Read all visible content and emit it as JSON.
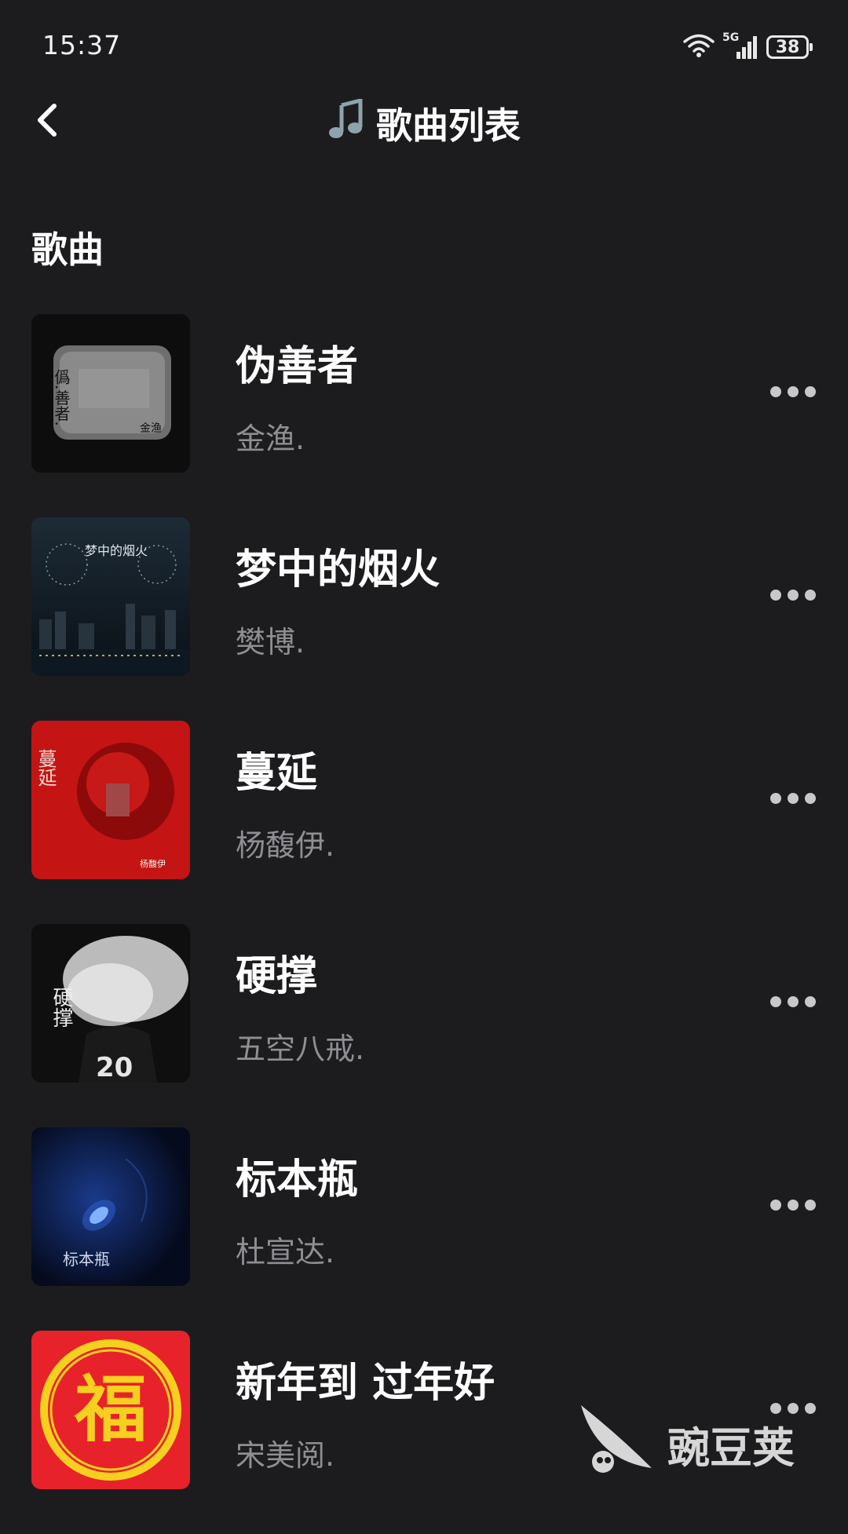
{
  "status_bar": {
    "time": "15:37",
    "network": "5G",
    "battery": "38"
  },
  "header": {
    "title": "歌曲列表",
    "back_icon": "chevron-left-icon",
    "title_icon": "music-note-icon"
  },
  "section": {
    "title": "歌曲"
  },
  "songs": [
    {
      "title": "伪善者",
      "artist": "金渔.",
      "cover_text": "僞.善者.",
      "cover_sub": "金渔"
    },
    {
      "title": "梦中的烟火",
      "artist": "樊博.",
      "cover_text": "梦中的烟火"
    },
    {
      "title": "蔓延",
      "artist": "杨馥伊.",
      "cover_text": "蔓延",
      "cover_sub": "杨馥伊"
    },
    {
      "title": "硬撑",
      "artist": "五空八戒.",
      "cover_text": "硬撑"
    },
    {
      "title": "标本瓶",
      "artist": "杜宣达.",
      "cover_text": "标本瓶"
    },
    {
      "title": "新年到 过年好",
      "artist": "宋美阅.",
      "cover_text": "福"
    }
  ],
  "watermark": {
    "text": "豌豆荚"
  },
  "colors": {
    "background": "#1c1c1e",
    "secondary_text": "#8e8e93",
    "accent": "#e8222a"
  }
}
